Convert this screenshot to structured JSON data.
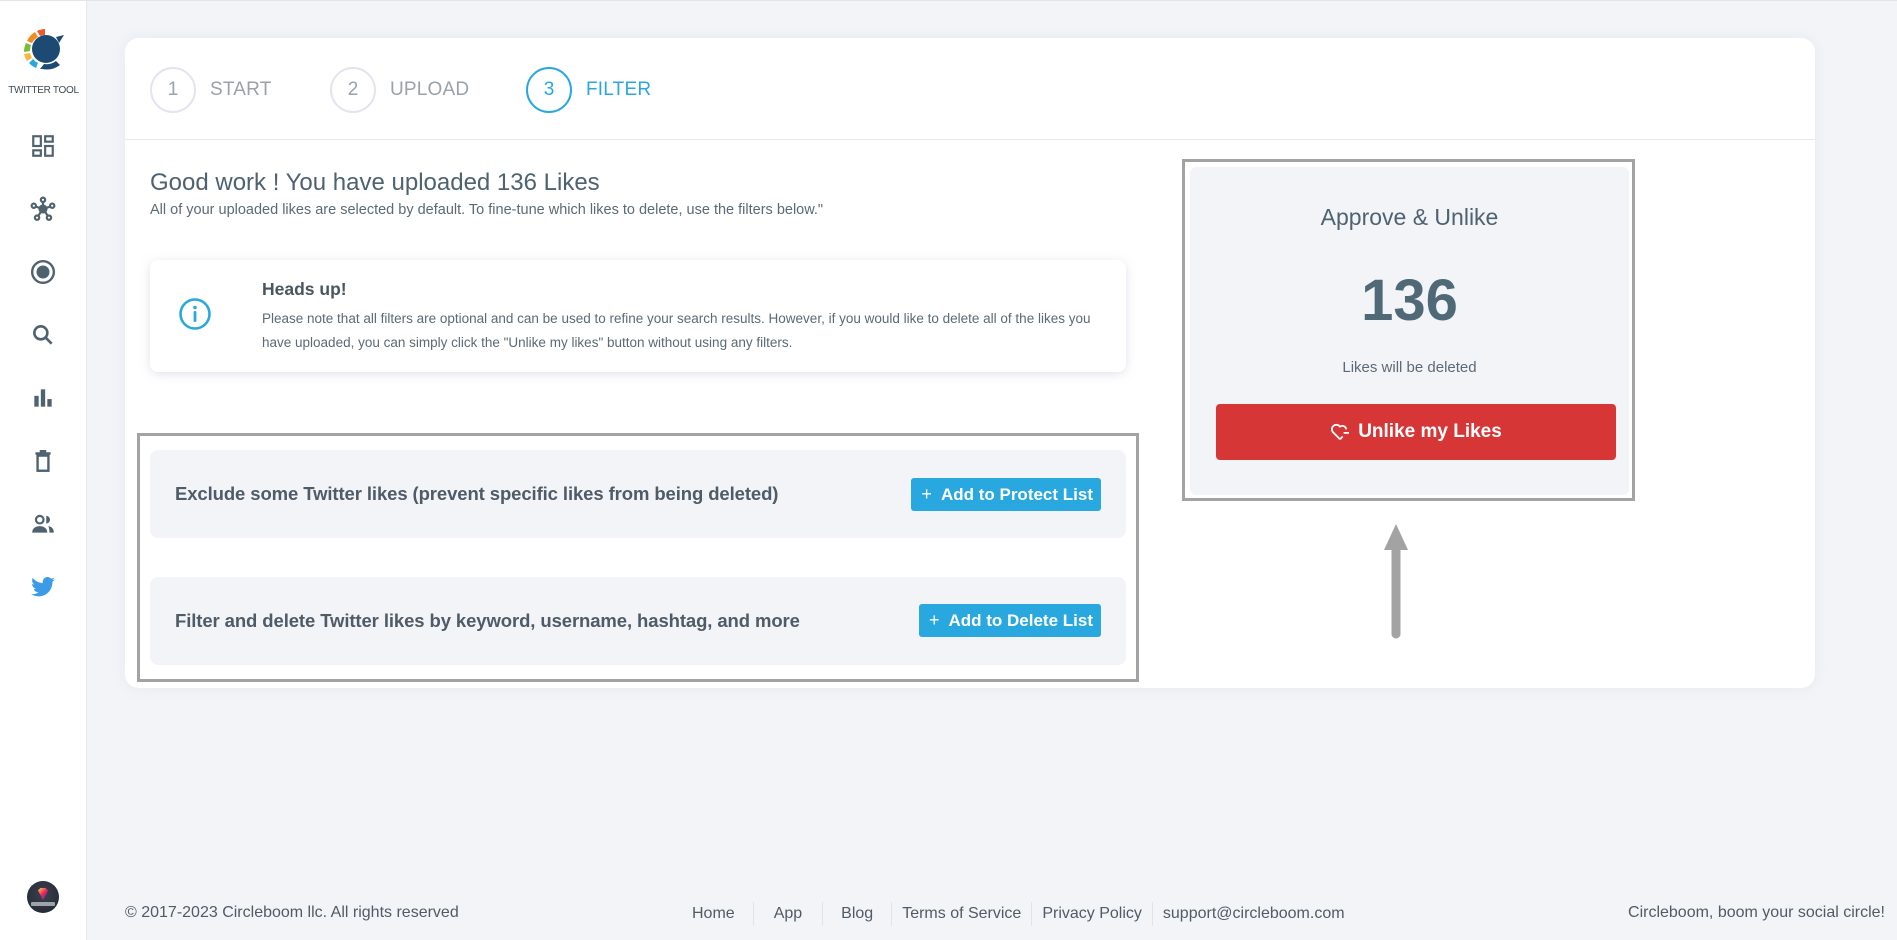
{
  "app": {
    "logo_text": "TWITTER TOOL",
    "brand_colors": {
      "primary": "#29a8e0",
      "danger": "#d73636",
      "logo_dark": "#1d4a72"
    }
  },
  "sidebar": {
    "items": [
      {
        "icon": "dashboard-icon",
        "label": "Dashboard"
      },
      {
        "icon": "network-icon",
        "label": "Circle"
      },
      {
        "icon": "radio-target-icon",
        "label": "Target"
      },
      {
        "icon": "search-icon",
        "label": "Search"
      },
      {
        "icon": "bar-chart-icon",
        "label": "Analytics"
      },
      {
        "icon": "trash-icon",
        "label": "Delete"
      },
      {
        "icon": "users-icon",
        "label": "Users"
      },
      {
        "icon": "twitter-bird-icon",
        "label": "Twitter"
      }
    ],
    "avatar_label": "Marketing"
  },
  "steps": [
    {
      "number": "1",
      "label": "START",
      "active": false
    },
    {
      "number": "2",
      "label": "UPLOAD",
      "active": false
    },
    {
      "number": "3",
      "label": "FILTER",
      "active": true
    }
  ],
  "main": {
    "headline": "Good work ! You have uploaded 136 Likes",
    "subline": "All of your uploaded likes are selected by default. To fine-tune which likes to delete, use the filters below.\"",
    "alert": {
      "icon": "info-icon",
      "title": "Heads up!",
      "body": "Please note that all filters are optional and can be used to refine your search results. However, if you would like to delete all of the likes you have uploaded, you can simply click the \"Unlike my likes\" button without using any filters."
    },
    "filters": [
      {
        "text": "Exclude some Twitter likes (prevent specific likes from being deleted)",
        "button": "Add to Protect List",
        "button_icon": "+"
      },
      {
        "text": "Filter and delete Twitter likes by keyword, username, hashtag, and more",
        "button": "Add to Delete List",
        "button_icon": "+"
      }
    ]
  },
  "approve": {
    "title": "Approve & Unlike",
    "count": "136",
    "note": "Likes will be deleted",
    "button": "Unlike my Likes",
    "button_icon": "heart-minus-icon"
  },
  "footer": {
    "copyright": "© 2017-2023 Circleboom llc. All rights reserved",
    "links": [
      "Home",
      "App",
      "Blog",
      "Terms of Service",
      "Privacy Policy",
      "support@circleboom.com"
    ],
    "tagline": "Circleboom, boom your social circle!"
  }
}
